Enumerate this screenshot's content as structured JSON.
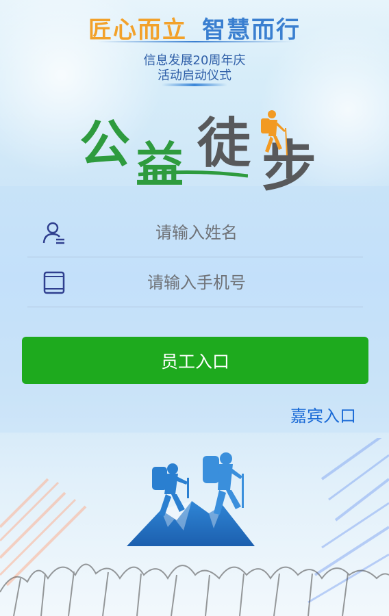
{
  "header": {
    "slogan_part1": "匠心而立",
    "slogan_part2": "智慧而行",
    "subtitle_line1": "信息发展20周年庆",
    "subtitle_line2": "活动启动仪式"
  },
  "logo": {
    "text": "公益徒步",
    "char1": "公",
    "char2": "益",
    "char3": "徒",
    "char4": "步",
    "green": "#2e9b3e",
    "gray": "#58595b",
    "hiker_color": "#f29a23"
  },
  "form": {
    "name_field": {
      "placeholder": "请输入姓名",
      "value": "",
      "icon": "user-icon"
    },
    "phone_field": {
      "placeholder": "请输入手机号",
      "value": "",
      "icon": "tablet-icon"
    },
    "employee_button_label": "员工入口",
    "guest_link_label": "嘉宾入口"
  },
  "colors": {
    "button": "#1eaa1e",
    "link": "#1a6ad6",
    "icon": "#2f3f8f"
  }
}
